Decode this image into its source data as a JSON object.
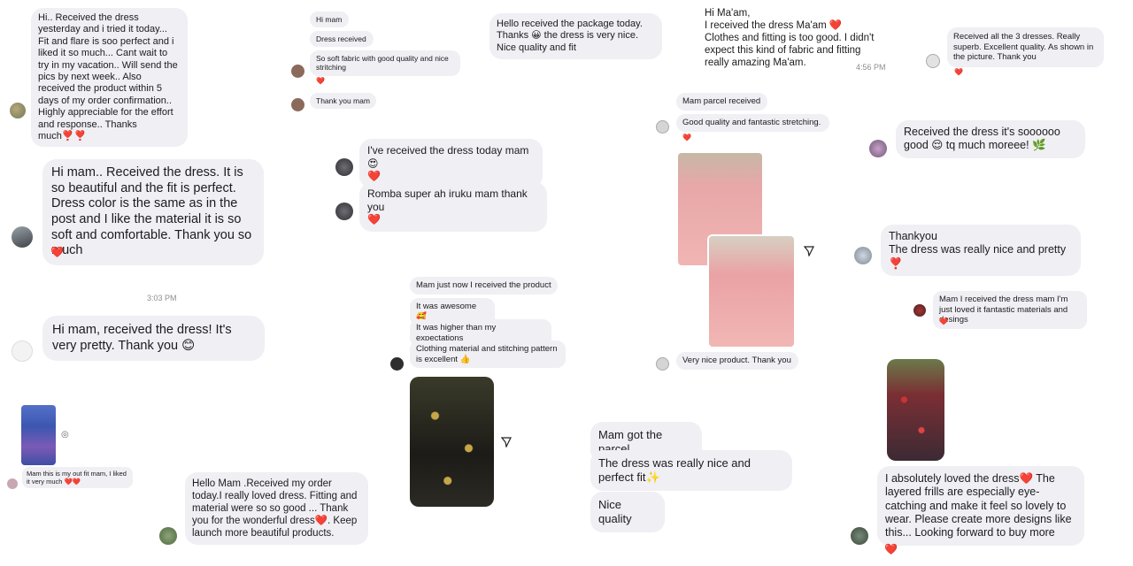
{
  "messages": {
    "m1": "Hi.. Received the dress yesterday and i tried it today... Fit and flare is soo perfect and i liked it so much... Cant wait to try in my vacation.. Will send the pics by next week.. Also received the product within 5 days of my order confirmation.. Highly appreciable for the effort and response.. Thanks much❣️❣️",
    "m2": "Hi mam.. Received the dress. It is so beautiful and the fit is perfect. Dress color is the same as in the post and I like the material it is so soft and comfortable. Thank you so much",
    "m3": "Hi mam, received the dress! It's very pretty. Thank you 😊",
    "m4": "Mam this is my out fit mam, I liked it very much ❤️❤️",
    "m5": "Hello Mam .Received my order today.I really loved dress. Fitting and material were so so good ...  Thank you for the wonderful dress❤️. Keep launch more beautiful products.",
    "m6a": "Hi mam",
    "m6b": "Dress received",
    "m6c": "So soft fabric with good quality and nice stritching",
    "m6d": "Thank you mam",
    "m7a": "I've received the dress today mam😍\n❤️",
    "m7b": "Romba super ah iruku mam thank you\n❤️",
    "m8": "Hello received the package today. Thanks 😀 the dress is very nice. Nice quality and fit",
    "m9a": "Mam just now I received the product",
    "m9b": "It was awesome 🥰",
    "m9c": "It was higher than my expectations",
    "m9d": "Clothing material and stitching pattern is excellent 👍",
    "m10": "Hi Ma'am,\nI received the dress Ma'am ❤️\nClothes and fitting is too good. I didn't expect this kind of fabric and fitting really amazing Ma'am.",
    "m10_time": "4:56 PM",
    "m11a": "Mam parcel received",
    "m11b": "Good quality and fantastic stretching.",
    "m11c": "Very nice product. Thank you",
    "m12a": "Mam got the parcel",
    "m12b": "The dress was really nice and perfect fit✨",
    "m12c": "Nice quality",
    "m13": "Received all the 3 dresses. Really superb. Excellent quality. As shown in the picture. Thank you",
    "m14": "Received the dress it's soooooo good 😌 tq much moreee! 🌿",
    "m15": "Thankyou\nThe dress was really nice and pretty ❣️",
    "m16": "Mam I received the dress mam I'm just loved it fantastic materials and desings",
    "m17": "I absolutely loved the dress❤️ The layered frills are especially eye-catching and make it feel so lovely to wear. Please create more designs like this... Looking forward to buy more",
    "cut_time": "3:03 PM"
  },
  "reactions": {
    "heart": "❤️"
  },
  "icons": {
    "reply": "send-icon",
    "camera": "camera-icon"
  },
  "colors": {
    "bubble": "#efeff4",
    "heart": "#e0182d",
    "background": "#ffffff"
  }
}
